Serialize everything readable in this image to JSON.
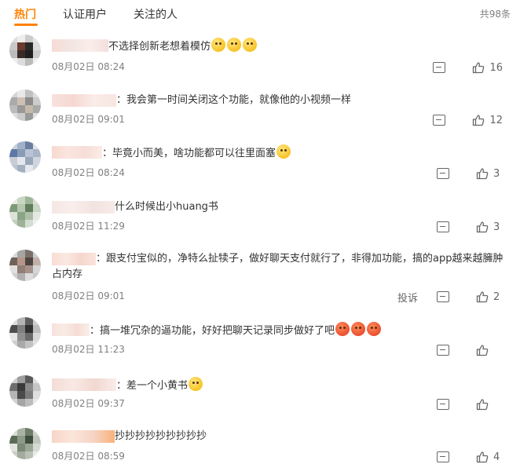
{
  "tabs": [
    {
      "label": "热门",
      "active": true
    },
    {
      "label": "认证用户",
      "active": false
    },
    {
      "label": "关注的人",
      "active": false
    }
  ],
  "total_count": "共98条",
  "report_label": "投诉",
  "comments": [
    {
      "separator": "",
      "text": "不选择创新老想着模仿",
      "emojis": [
        "yellow",
        "yellow",
        "yellow"
      ],
      "time": "08月02日 08:24",
      "likes": "16"
    },
    {
      "separator": "：",
      "text": "我会第一时间关闭这个功能，就像他的小视频一样",
      "emojis": [],
      "time": "08月02日 09:01",
      "likes": "12"
    },
    {
      "separator": "：",
      "text": "毕竟小而美，啥功能都可以往里面塞",
      "emojis": [
        "yellow"
      ],
      "time": "08月02日 08:24",
      "likes": "3"
    },
    {
      "separator": "",
      "text": "什么时候出小huang书",
      "emojis": [],
      "time": "08月02日 11:29",
      "likes": "3"
    },
    {
      "separator": "：",
      "text": "跟支付宝似的，净特么扯犊子，做好聊天支付就行了，非得加功能，搞的app越来越臃肿占内存",
      "emojis": [],
      "time": "08月02日 09:01",
      "likes": "2"
    },
    {
      "separator": "：",
      "text": "搞一堆冗杂的逼功能，好好把聊天记录同步做好了吧",
      "emojis": [
        "red",
        "red",
        "red"
      ],
      "time": "08月02日 11:23",
      "likes": ""
    },
    {
      "separator": "：",
      "text": "差一个小黄书",
      "emojis": [
        "yellow"
      ],
      "time": "08月02日 09:37",
      "likes": ""
    },
    {
      "separator": "",
      "text": "抄抄抄抄抄抄抄抄抄",
      "emojis": [],
      "time": "08月02日 08:59",
      "likes": "4"
    }
  ],
  "colors": {
    "accent": "#ff8200",
    "meta": "#808080",
    "text": "#333333"
  },
  "icons": {
    "comment": "comment-icon",
    "like": "thumbs-up-icon"
  }
}
